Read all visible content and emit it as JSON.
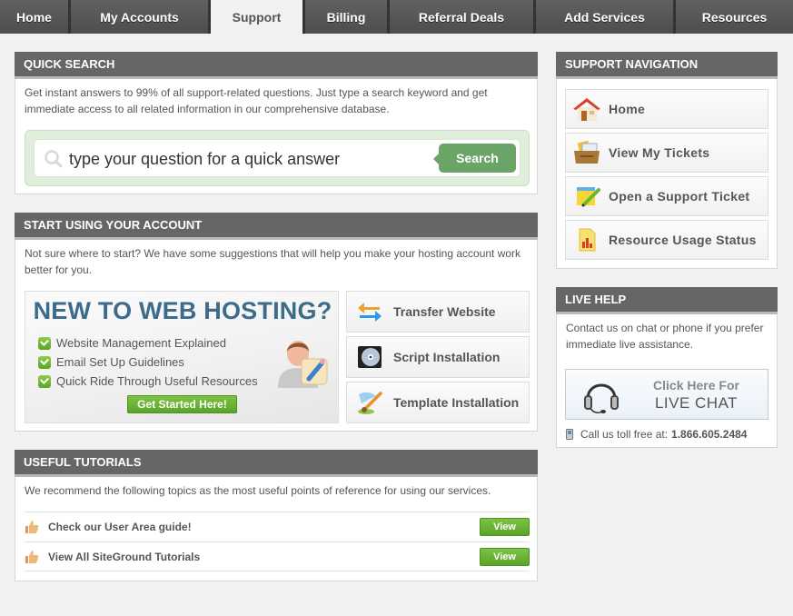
{
  "nav": {
    "tabs": [
      {
        "label": "Home",
        "active": false
      },
      {
        "label": "My Accounts",
        "active": false
      },
      {
        "label": "Support",
        "active": true
      },
      {
        "label": "Billing",
        "active": false
      },
      {
        "label": "Referral Deals",
        "active": false
      },
      {
        "label": "Add Services",
        "active": false
      },
      {
        "label": "Resources",
        "active": false
      }
    ]
  },
  "quick_search": {
    "title": "QUICK SEARCH",
    "description": "Get instant answers to 99% of all support-related questions. Just type a search keyword and get immediate access to all related information in our comprehensive database.",
    "placeholder": "type your question for a quick answer",
    "value": "",
    "button_label": "Search",
    "icon": "search-icon"
  },
  "start_using": {
    "title": "START USING YOUR ACCOUNT",
    "description": "Not sure where to start? We have some suggestions that will help you make your hosting account work better for you.",
    "banner": {
      "title": "NEW TO WEB HOSTING?",
      "items": [
        "Website Management Explained",
        "Email Set Up Guidelines",
        "Quick Ride Through Useful Resources"
      ],
      "button_label": "Get Started Here!"
    },
    "actions": [
      {
        "label": "Transfer Website",
        "icon": "transfer-arrows-icon"
      },
      {
        "label": "Script Installation",
        "icon": "cd-disc-icon"
      },
      {
        "label": "Template Installation",
        "icon": "paintbrush-icon"
      }
    ]
  },
  "tutorials": {
    "title": "USEFUL TUTORIALS",
    "description": "We recommend the following topics as the most useful points of reference for using our services.",
    "items": [
      {
        "label": "Check our User Area guide!",
        "button_label": "View"
      },
      {
        "label": "View All SiteGround Tutorials",
        "button_label": "View"
      }
    ]
  },
  "support_nav": {
    "title": "SUPPORT NAVIGATION",
    "items": [
      {
        "label": "Home",
        "icon": "house-icon"
      },
      {
        "label": "View My Tickets",
        "icon": "inbox-tray-icon"
      },
      {
        "label": "Open a Support Ticket",
        "icon": "notepad-pencil-icon"
      },
      {
        "label": "Resource Usage Status",
        "icon": "bar-chart-document-icon"
      }
    ]
  },
  "live_help": {
    "title": "LIVE HELP",
    "description": "Contact us on chat or phone if you prefer immediate live assistance.",
    "chat_line1": "Click Here For",
    "chat_line2": "LIVE CHAT",
    "phone_label": "Call us toll free at:",
    "phone_number": "1.866.605.2484"
  },
  "colors": {
    "header_bg": "#666666",
    "nav_bg": "#4d4d4d",
    "accent_green": "#6aa467",
    "button_green": "#5aa429",
    "banner_title": "#3d6b8a",
    "page_bg": "#f1f1f1"
  }
}
